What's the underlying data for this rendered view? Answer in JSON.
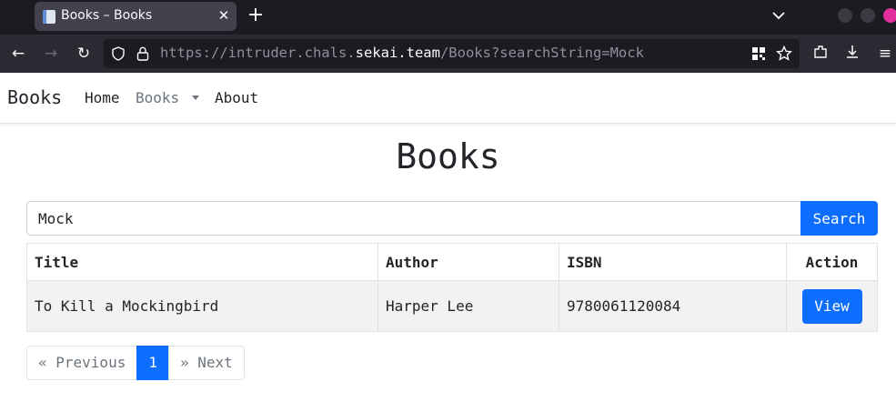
{
  "browser": {
    "tab_title": "Books – Books",
    "url_prefix": "https://intruder.chals.",
    "url_domain": "sekai.team",
    "url_suffix": "/Books?searchString=Mock"
  },
  "site_nav": {
    "brand": "Books",
    "links": [
      {
        "label": "Home",
        "active": false
      },
      {
        "label": "Books",
        "active": true,
        "dropdown": true
      },
      {
        "label": "About",
        "active": false
      }
    ]
  },
  "main": {
    "title": "Books",
    "search": {
      "value": "Mock",
      "button_label": "Search"
    },
    "table": {
      "headers": [
        "Title",
        "Author",
        "ISBN",
        "Action"
      ],
      "rows": [
        {
          "title": "To Kill a Mockingbird",
          "author": "Harper Lee",
          "isbn": "9780061120084",
          "action": "View"
        }
      ]
    },
    "pagination": {
      "previous": "« Previous",
      "current": "1",
      "next": "» Next"
    }
  },
  "colors": {
    "primary": "#0d6efd",
    "tabbar_bg": "#1c1b22",
    "toolbar_bg": "#2b2a33",
    "row_stripe": "#f2f2f2"
  }
}
